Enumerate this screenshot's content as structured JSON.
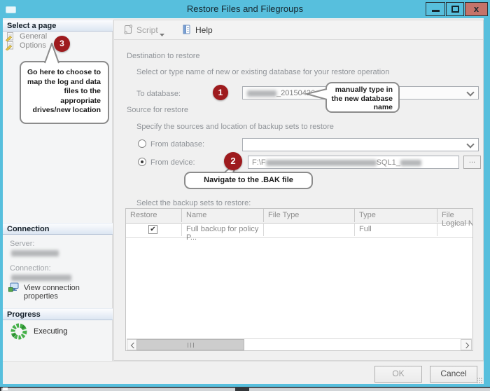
{
  "window": {
    "title": "Restore Files and Filegroups",
    "close_glyph": "x"
  },
  "toolbar": {
    "script_label": "Script",
    "help_label": "Help"
  },
  "sidebar": {
    "select_page_header": "Select a page",
    "pages": [
      {
        "label": "General"
      },
      {
        "label": "Options"
      }
    ],
    "connection": {
      "header": "Connection",
      "server_label": "Server:",
      "connection_label": "Connection:",
      "link_label": "View connection properties"
    },
    "progress": {
      "header": "Progress",
      "status": "Executing"
    }
  },
  "content": {
    "destination_section_label": "Destination to restore",
    "destination_hint": "Select or type name of new or existing database for your restore operation",
    "to_database_label": "To database:",
    "to_database_value_suffix": "_20150426",
    "source_section_label": "Source for restore",
    "source_hint": "Specify the sources and location of backup sets to restore",
    "from_database_label": "From database:",
    "from_device_label": "From device:",
    "device_path_prefix": "F:\\F",
    "device_path_mid": "SQL1_",
    "browse_label": "...",
    "backup_sets_label": "Select the backup sets to restore:"
  },
  "table": {
    "columns": [
      "Restore",
      "Name",
      "File Type",
      "Type",
      "File Logical N"
    ],
    "row": {
      "checked": true,
      "check_glyph": "✔",
      "name": "Full backup for policy P...",
      "file_type": "",
      "type": "Full",
      "file_logical_name": ""
    }
  },
  "callouts": {
    "one": {
      "number": "1",
      "lines": [
        "manually type in",
        "the new database",
        "name"
      ]
    },
    "two": {
      "number": "2",
      "text": "Navigate to the .BAK file"
    },
    "three": {
      "number": "3",
      "lines": [
        "Go here to choose to",
        "map the log and data",
        "files to the",
        "appropriate",
        "drives/new location"
      ]
    }
  },
  "footer": {
    "ok_label": "OK",
    "cancel_label": "Cancel"
  },
  "colors": {
    "titlebar": "#57bfdd",
    "close_button": "#c4736a",
    "callout_red": "#9e1b1e",
    "progress_green": "#45b049"
  }
}
